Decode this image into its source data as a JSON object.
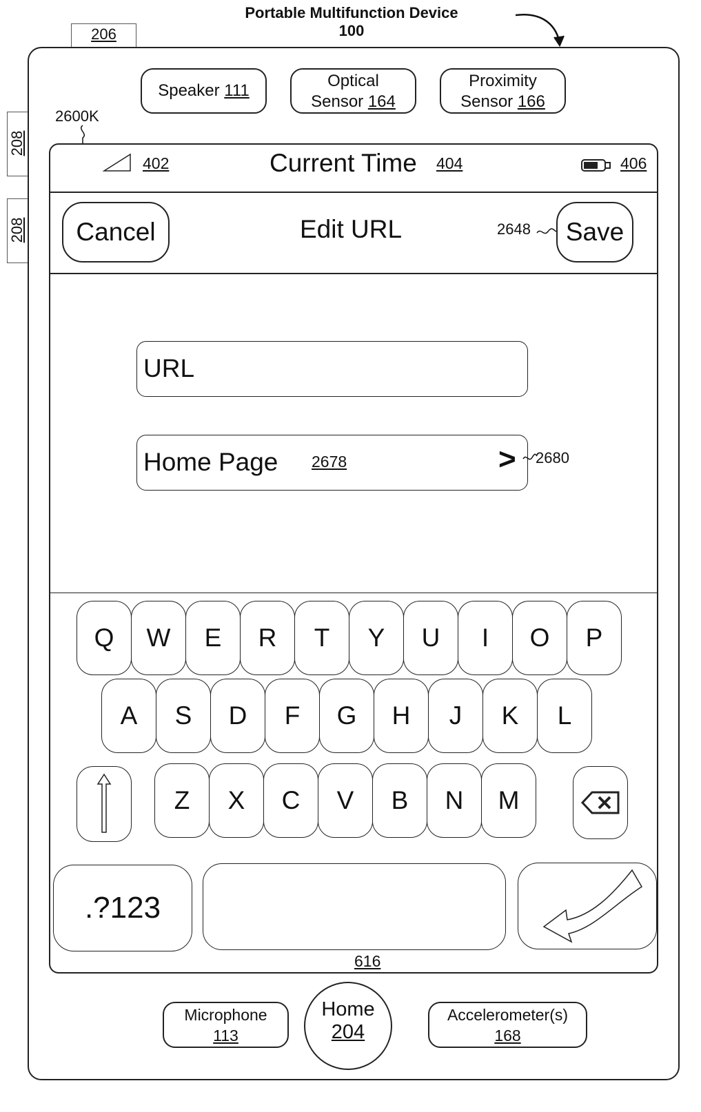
{
  "header": {
    "title": "Portable Multifunction Device",
    "device_ref": "100"
  },
  "side_refs": {
    "top_button": "206",
    "side_button_1": "208",
    "side_button_2": "208"
  },
  "sensors": {
    "speaker": {
      "label": "Speaker",
      "ref": "111"
    },
    "optical": {
      "line1": "Optical",
      "line2": "Sensor",
      "ref": "164"
    },
    "proximity": {
      "line1": "Proximity",
      "line2": "Sensor",
      "ref": "166"
    }
  },
  "screen_ref": "2600K",
  "status_bar": {
    "signal_ref": "402",
    "time_label": "Current Time",
    "time_ref": "404",
    "battery_ref": "406"
  },
  "nav": {
    "cancel": "Cancel",
    "title": "Edit URL",
    "save": "Save",
    "save_ref": "2648"
  },
  "fields": {
    "url_placeholder": "URL",
    "home_page_label": "Home Page",
    "home_page_ref": "2678",
    "chevron": ">",
    "chevron_ref": "2680"
  },
  "keyboard": {
    "row1": [
      "Q",
      "W",
      "E",
      "R",
      "T",
      "Y",
      "U",
      "I",
      "O",
      "P"
    ],
    "row2": [
      "A",
      "S",
      "D",
      "F",
      "G",
      "H",
      "J",
      "K",
      "L"
    ],
    "row3": [
      "Z",
      "X",
      "C",
      "V",
      "B",
      "N",
      "M"
    ],
    "numbers_key": ".?123",
    "keyboard_ref": "616"
  },
  "bottom": {
    "microphone": {
      "label": "Microphone",
      "ref": "113"
    },
    "home": {
      "label": "Home",
      "ref": "204"
    },
    "accelerometer": {
      "label": "Accelerometer(s)",
      "ref": "168"
    }
  }
}
